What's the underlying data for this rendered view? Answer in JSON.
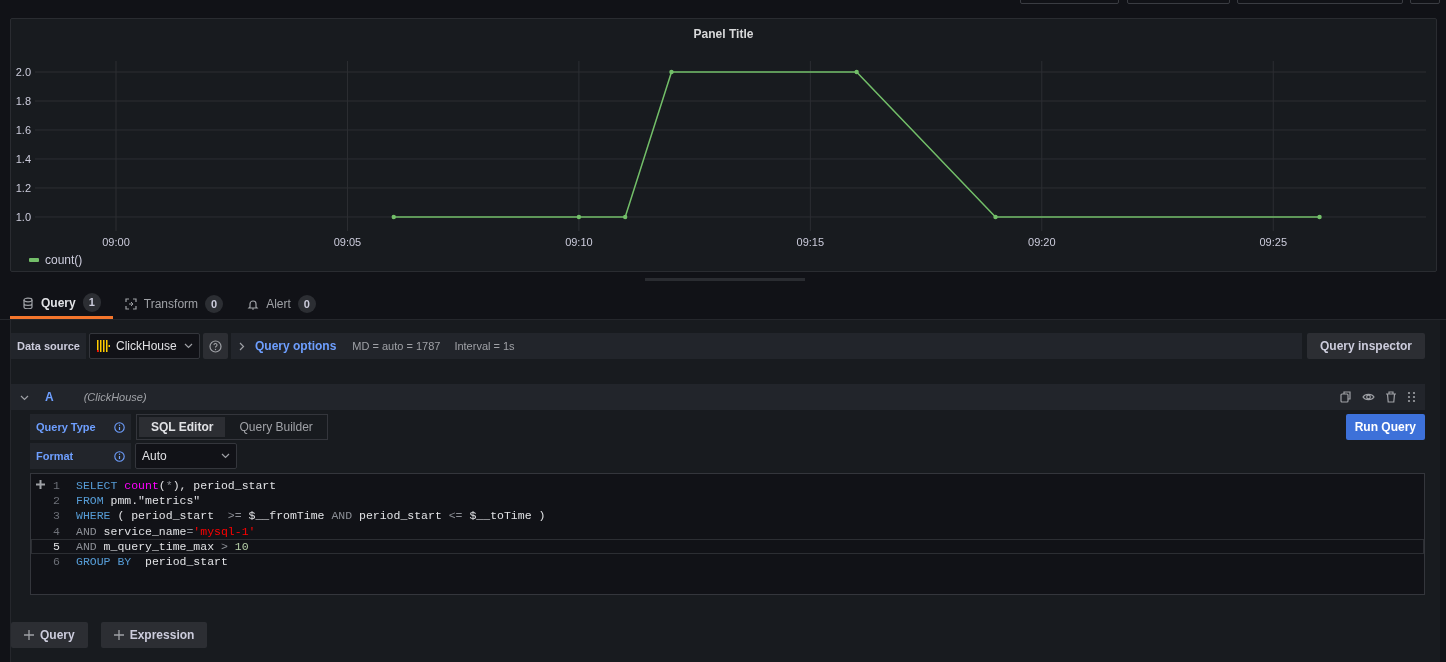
{
  "panel": {
    "title": "Panel Title",
    "chart_data": {
      "type": "line",
      "grid": true,
      "x": [
        546,
        550,
        551,
        552,
        556,
        559,
        566
      ],
      "xlim": [
        538.25,
        568.3
      ],
      "ylim": [
        0.903,
        2.076
      ],
      "xticks": [
        {
          "value": 540,
          "label": "09:00"
        },
        {
          "value": 545,
          "label": "09:05"
        },
        {
          "value": 550,
          "label": "09:10"
        },
        {
          "value": 555,
          "label": "09:15"
        },
        {
          "value": 560,
          "label": "09:20"
        },
        {
          "value": 565,
          "label": "09:25"
        }
      ],
      "yticks": [
        {
          "value": 1,
          "label": "1.0"
        },
        {
          "value": 1.2,
          "label": "1.2"
        },
        {
          "value": 1.4,
          "label": "1.4"
        },
        {
          "value": 1.6,
          "label": "1.6"
        },
        {
          "value": 1.8,
          "label": "1.8"
        },
        {
          "value": 2,
          "label": "2.0"
        }
      ],
      "series": [
        {
          "name": "count()",
          "color": "#73bf69",
          "values": [
            1,
            1,
            1,
            2,
            2,
            1,
            1
          ]
        }
      ]
    }
  },
  "tabs": [
    {
      "label": "Query",
      "count": "1",
      "selected": true
    },
    {
      "label": "Transform",
      "count": "0",
      "selected": false
    },
    {
      "label": "Alert",
      "count": "0",
      "selected": false
    }
  ],
  "datasource": {
    "label": "Data source",
    "value": "ClickHouse",
    "options_label": "Query options",
    "options_info": [
      "MD = auto = 1787",
      "Interval = 1s"
    ],
    "inspector": "Query inspector"
  },
  "query": {
    "ref": "A",
    "datasource": "(ClickHouse)",
    "expanded": true,
    "query_type": {
      "label": "Query Type",
      "options": [
        {
          "label": "SQL Editor",
          "selected": true
        },
        {
          "label": "Query Builder",
          "selected": false
        }
      ]
    },
    "format": {
      "label": "Format",
      "value": "Auto"
    },
    "run": "Run Query",
    "code": [
      {
        "number": "1",
        "active": false,
        "tokens": [
          {
            "kind": "keyword",
            "text": "SELECT "
          },
          {
            "kind": "function",
            "text": "count"
          },
          {
            "kind": "plain",
            "text": "("
          },
          {
            "kind": "operator",
            "text": "*"
          },
          {
            "kind": "plain",
            "text": "), period_start"
          }
        ]
      },
      {
        "number": "2",
        "active": false,
        "tokens": [
          {
            "kind": "keyword",
            "text": "FROM"
          },
          {
            "kind": "plain",
            "text": " pmm.\"metrics\""
          }
        ]
      },
      {
        "number": "3",
        "active": false,
        "tokens": [
          {
            "kind": "keyword",
            "text": "WHERE"
          },
          {
            "kind": "plain",
            "text": " ( period_start  "
          },
          {
            "kind": "operator",
            "text": ">="
          },
          {
            "kind": "plain",
            "text": " $__fromTime "
          },
          {
            "kind": "operator",
            "text": "AND"
          },
          {
            "kind": "plain",
            "text": " period_start "
          },
          {
            "kind": "operator",
            "text": "<="
          },
          {
            "kind": "plain",
            "text": " $__toTime )"
          }
        ]
      },
      {
        "number": "4",
        "active": false,
        "tokens": [
          {
            "kind": "operator",
            "text": "AND"
          },
          {
            "kind": "plain",
            "text": " service_name"
          },
          {
            "kind": "operator",
            "text": "="
          },
          {
            "kind": "string",
            "text": "'mysql-1'"
          }
        ]
      },
      {
        "number": "5",
        "active": true,
        "tokens": [
          {
            "kind": "operator",
            "text": "AND"
          },
          {
            "kind": "plain",
            "text": " m_query_time_max "
          },
          {
            "kind": "operator",
            "text": "> "
          },
          {
            "kind": "number",
            "text": "10"
          }
        ]
      },
      {
        "number": "6",
        "active": false,
        "tokens": [
          {
            "kind": "keyword",
            "text": "GROUP BY"
          },
          {
            "kind": "plain",
            "text": "  period_start"
          }
        ]
      }
    ]
  },
  "add_buttons": [
    "Query",
    "Expression"
  ]
}
